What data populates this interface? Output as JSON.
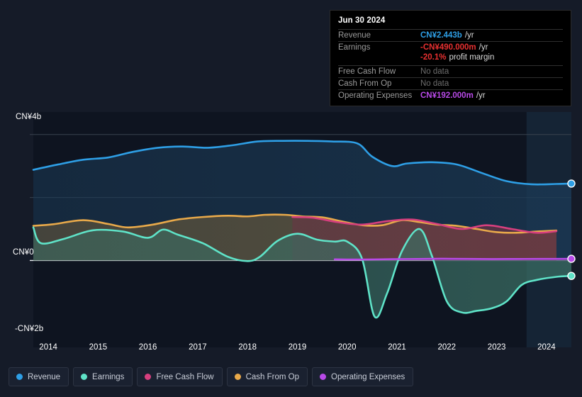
{
  "chart_data": {
    "type": "area",
    "title": "",
    "xlabel": "",
    "ylabel": "",
    "currency": "CN¥",
    "ylim": [
      -2.4,
      4.4
    ],
    "y_ticks": [
      {
        "label": "CN¥4b",
        "value": 4
      },
      {
        "label": "CN¥0",
        "value": 0
      },
      {
        "label": "-CN¥2b",
        "value": -2
      }
    ],
    "gridlines": [
      4,
      2,
      0
    ],
    "x_ticks": [
      "2014",
      "2015",
      "2016",
      "2017",
      "2018",
      "2019",
      "2020",
      "2021",
      "2022",
      "2023",
      "2024"
    ],
    "x_range": [
      "2013.7",
      "2024.5"
    ],
    "legend_position": "bottom",
    "forecast_band_start": "2023.6",
    "series": [
      {
        "name": "Revenue",
        "color": "#2e9fe6",
        "fill": "#1b3a56",
        "unit": "b",
        "x": [
          2013.7,
          2014.2,
          2014.7,
          2015.2,
          2015.7,
          2016.2,
          2016.7,
          2017.2,
          2017.7,
          2018.2,
          2018.7,
          2019.2,
          2019.7,
          2020.2,
          2020.5,
          2020.9,
          2021.2,
          2021.7,
          2022.2,
          2022.7,
          2023.2,
          2023.7,
          2024.2,
          2024.5
        ],
        "values": [
          2.88,
          3.05,
          3.2,
          3.27,
          3.45,
          3.58,
          3.62,
          3.58,
          3.66,
          3.78,
          3.8,
          3.8,
          3.78,
          3.72,
          3.3,
          3.0,
          3.08,
          3.12,
          3.05,
          2.78,
          2.52,
          2.42,
          2.43,
          2.443
        ]
      },
      {
        "name": "Earnings",
        "color": "#5fe3c8",
        "fill": "#3a6d63",
        "unit": "b",
        "x": [
          2013.7,
          2013.85,
          2014.3,
          2014.9,
          2015.5,
          2016.0,
          2016.3,
          2016.6,
          2017.1,
          2017.6,
          2018.0,
          2018.25,
          2018.6,
          2019.0,
          2019.4,
          2019.75,
          2020.0,
          2020.3,
          2020.55,
          2020.8,
          2021.1,
          2021.45,
          2021.7,
          2022.0,
          2022.3,
          2022.6,
          2022.9,
          2023.2,
          2023.5,
          2023.8,
          2024.2,
          2024.5
        ],
        "values": [
          1.05,
          0.55,
          0.68,
          0.96,
          0.92,
          0.72,
          0.98,
          0.82,
          0.55,
          0.12,
          -0.02,
          0.12,
          0.62,
          0.85,
          0.66,
          0.6,
          0.6,
          0.05,
          -1.78,
          -1.05,
          0.3,
          1.0,
          0.15,
          -1.3,
          -1.65,
          -1.6,
          -1.52,
          -1.3,
          -0.78,
          -0.62,
          -0.52,
          -0.49
        ]
      },
      {
        "name": "Free Cash Flow",
        "color": "#d63f7e",
        "fill": "#6b3244",
        "unit": "b",
        "starts_at": "2018.9",
        "x": [
          2018.9,
          2019.3,
          2019.8,
          2020.3,
          2020.8,
          2021.3,
          2021.8,
          2022.3,
          2022.8,
          2023.3,
          2023.8,
          2024.2
        ],
        "values": [
          1.38,
          1.36,
          1.22,
          1.14,
          1.25,
          1.3,
          1.16,
          1.0,
          1.12,
          1.0,
          0.88,
          0.93
        ]
      },
      {
        "name": "Cash From Op",
        "color": "#e8a94a",
        "fill": "#6b5a3a",
        "unit": "b",
        "x": [
          2013.7,
          2014.1,
          2014.7,
          2015.2,
          2015.6,
          2016.1,
          2016.6,
          2017.1,
          2017.6,
          2018.0,
          2018.35,
          2018.75,
          2019.1,
          2019.5,
          2019.9,
          2020.3,
          2020.7,
          2021.1,
          2021.45,
          2021.8,
          2022.2,
          2022.6,
          2023.0,
          2023.4,
          2023.8,
          2024.2
        ],
        "values": [
          1.1,
          1.15,
          1.28,
          1.16,
          1.05,
          1.14,
          1.3,
          1.38,
          1.42,
          1.4,
          1.45,
          1.45,
          1.4,
          1.37,
          1.24,
          1.12,
          1.12,
          1.28,
          1.22,
          1.14,
          1.1,
          1.0,
          0.9,
          0.88,
          0.92,
          0.95
        ]
      },
      {
        "name": "Operating Expenses",
        "color": "#b84ae8",
        "fill": "#54306b",
        "unit": "m",
        "starts_at": "2019.75",
        "x": [
          2019.75,
          2020.3,
          2020.9,
          2021.4,
          2021.9,
          2022.4,
          2022.9,
          2023.4,
          2023.9,
          2024.5
        ],
        "values": [
          0.035,
          0.03,
          0.042,
          0.048,
          0.055,
          0.05,
          0.045,
          0.048,
          0.05,
          0.052
        ]
      }
    ]
  },
  "tooltip": {
    "date": "Jun 30 2024",
    "rows": [
      {
        "label": "Revenue",
        "value": "CN¥2.443b",
        "unit": "/yr",
        "color": "#2e9fe6",
        "nodata": false
      },
      {
        "label": "Earnings",
        "value": "-CN¥490.000m",
        "unit": "/yr",
        "color": "#e83030",
        "nodata": false
      },
      {
        "label": "",
        "value": "-20.1%",
        "unit": "profit margin",
        "color": "#e83030",
        "nodata": false,
        "continuation": true
      },
      {
        "label": "Free Cash Flow",
        "value": "No data",
        "unit": "",
        "color": "#6d6d6d",
        "nodata": true
      },
      {
        "label": "Cash From Op",
        "value": "No data",
        "unit": "",
        "color": "#6d6d6d",
        "nodata": true
      },
      {
        "label": "Operating Expenses",
        "value": "CN¥192.000m",
        "unit": "/yr",
        "color": "#b84ae8",
        "nodata": false
      }
    ]
  },
  "legend": {
    "items": [
      {
        "label": "Revenue",
        "color": "#2e9fe6"
      },
      {
        "label": "Earnings",
        "color": "#5fe3c8"
      },
      {
        "label": "Free Cash Flow",
        "color": "#d63f7e"
      },
      {
        "label": "Cash From Op",
        "color": "#e8a94a"
      },
      {
        "label": "Operating Expenses",
        "color": "#b84ae8"
      }
    ]
  }
}
